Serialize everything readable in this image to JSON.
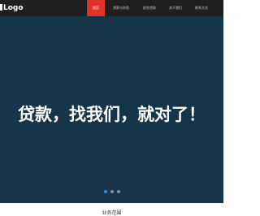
{
  "header": {
    "logo_text": "Logo",
    "nav": [
      {
        "label": "首页",
        "active": true
      },
      {
        "label": "贷款与利息",
        "active": false
      },
      {
        "label": "综合贷款",
        "active": false
      },
      {
        "label": "关于我们",
        "active": false
      },
      {
        "label": "联系方式",
        "active": false
      }
    ]
  },
  "banner": {
    "headline": "贷款，找我们，就对了！",
    "slide_count": 3,
    "active_slide": 1
  },
  "section": {
    "title": "业务范围"
  },
  "colors": {
    "nav_background": "#1f1f1f",
    "nav_active": "#e0322b",
    "banner_background": "#163548",
    "dot_active": "#2e8fd6",
    "dot_inactive": "#8a8f94"
  }
}
